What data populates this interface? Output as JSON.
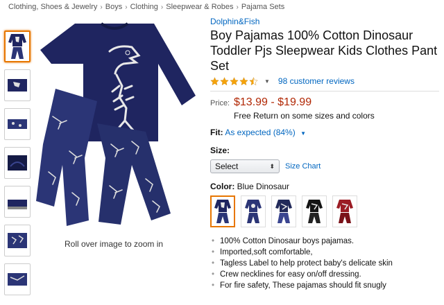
{
  "breadcrumb": [
    "Clothing, Shoes & Jewelry",
    "Boys",
    "Clothing",
    "Sleepwear & Robes",
    "Pajama Sets"
  ],
  "breadcrumb_separator": "›",
  "main_image": {
    "zoom_hint": "Roll over image to zoom in"
  },
  "product": {
    "brand": "Dolphin&Fish",
    "title": "Boy Pajamas 100% Cotton Dinosaur Toddler Pjs Sleepwear Kids Clothes Pant Set",
    "rating": 4.5,
    "rating_caret": "▼",
    "reviews_label": "98 customer reviews"
  },
  "price": {
    "label": "Price:",
    "value": "$13.99 - $19.99",
    "return_note": "Free Return on some sizes and colors"
  },
  "fit": {
    "label": "Fit:",
    "value": "As expected (84%)",
    "caret": "▼"
  },
  "size": {
    "label": "Size:",
    "selected": "Select",
    "arrows": "⬍",
    "chart_link": "Size Chart"
  },
  "color": {
    "label": "Color:",
    "selected": "Blue Dinosaur",
    "swatch_colors": [
      "#1f2560",
      "#2b3576",
      "#222a5a",
      "#141414",
      "#9b1c24"
    ]
  },
  "bullets": [
    "100% Cotton Dinosaur boys pajamas.",
    "Imported,soft comfortable,",
    "Tagless Label to help protect baby's delicate skin",
    "Crew necklines for easy on/off dressing.",
    "For fire safety, These pajamas should fit snugly"
  ],
  "colors": {
    "link": "#0066c0",
    "price": "#b12704",
    "star": "#f6a30a",
    "navy": "#1f2560",
    "selected_border": "#e77600"
  }
}
